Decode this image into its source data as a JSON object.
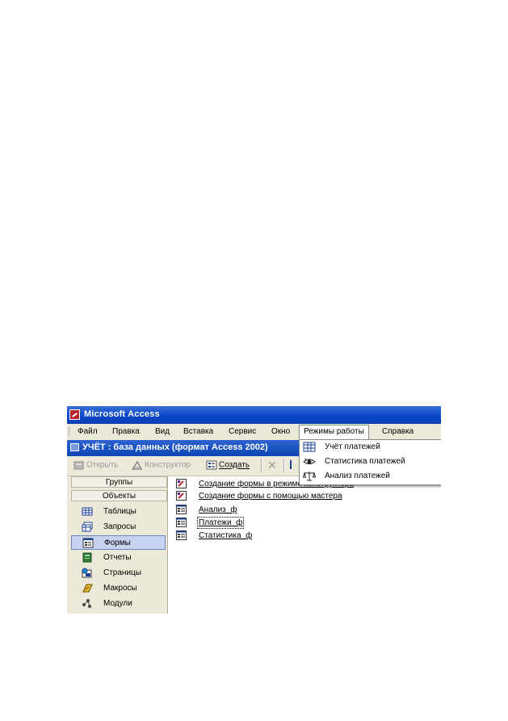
{
  "app": {
    "title": "Microsoft Access"
  },
  "menu": [
    {
      "label": "Файл"
    },
    {
      "label": "Правка"
    },
    {
      "label": "Вид"
    },
    {
      "label": "Вставка"
    },
    {
      "label": "Сервис"
    },
    {
      "label": "Окно"
    },
    {
      "label": "Режимы работы"
    },
    {
      "label": "Справка"
    }
  ],
  "database_window": {
    "title": "УЧЁТ : база данных (формат Access 2002)"
  },
  "toolbar": {
    "open_label": "Открыть",
    "design_label": "Конструктор",
    "create_label": "Создать"
  },
  "sidebar": {
    "groups_label": "Группы",
    "objects_label": "Объекты",
    "items": [
      {
        "label": "Таблицы",
        "icon": "table-icon"
      },
      {
        "label": "Запросы",
        "icon": "query-icon"
      },
      {
        "label": "Формы",
        "icon": "form-icon",
        "selected": true
      },
      {
        "label": "Отчеты",
        "icon": "report-icon"
      },
      {
        "label": "Страницы",
        "icon": "page-icon"
      },
      {
        "label": "Макросы",
        "icon": "macro-icon"
      },
      {
        "label": "Модули",
        "icon": "module-icon"
      }
    ]
  },
  "objects": [
    {
      "label": "Создание формы в режиме конструктора",
      "icon": "design-wizard-icon"
    },
    {
      "label": "Создание формы с помощью мастера",
      "icon": "design-wizard-icon"
    },
    {
      "label": "Анализ_ф",
      "icon": "form-icon"
    },
    {
      "label": "Платежи_ф",
      "icon": "form-icon",
      "focused": true
    },
    {
      "label": "Статистика_ф",
      "icon": "form-icon"
    }
  ],
  "modes_menu": {
    "items": [
      {
        "label": "Учёт платежей",
        "icon": "table-grid-icon"
      },
      {
        "label": "Статистика платежей",
        "icon": "eye-icon"
      },
      {
        "label": "Анализ платежей",
        "icon": "scales-icon"
      }
    ]
  },
  "colors": {
    "title_bar": "#0a47c9",
    "selection": "#c6d3ee",
    "chrome": "#ece9d8"
  }
}
